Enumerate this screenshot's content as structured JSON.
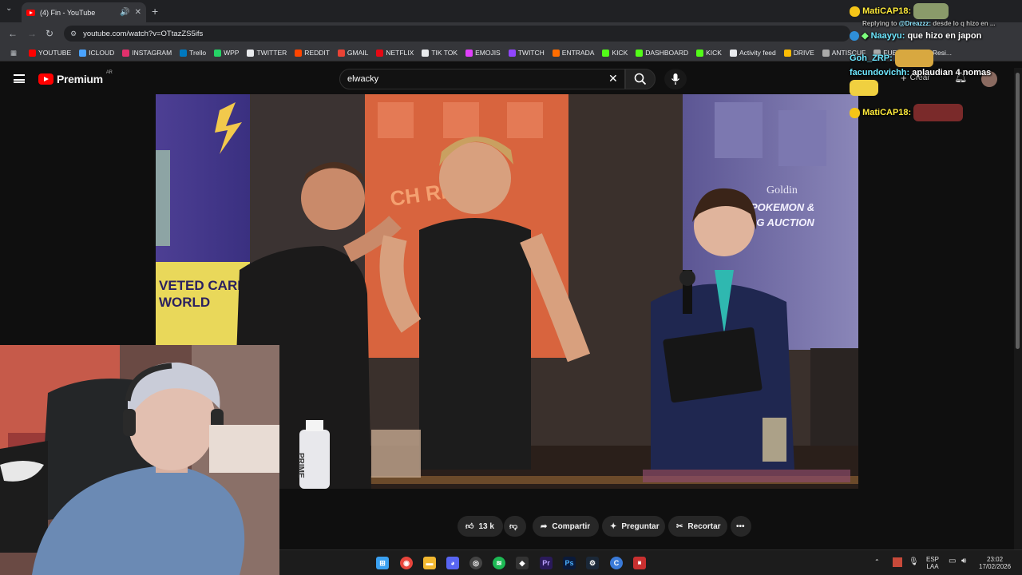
{
  "browser": {
    "tab_title": "(4) Fin - YouTube",
    "url": "youtube.com/watch?v=OTtazZS5ifs",
    "bookmarks": [
      {
        "label": "YOUTUBE",
        "color": "#ff0000"
      },
      {
        "label": "ICLOUD",
        "color": "#4aa3ff"
      },
      {
        "label": "INSTAGRAM",
        "color": "#e1306c"
      },
      {
        "label": "Trello",
        "color": "#0079bf"
      },
      {
        "label": "WPP",
        "color": "#25d366"
      },
      {
        "label": "TWITTER",
        "color": "#e8eaed"
      },
      {
        "label": "REDDIT",
        "color": "#ff4500"
      },
      {
        "label": "GMAIL",
        "color": "#ea4335"
      },
      {
        "label": "NETFLIX",
        "color": "#e50914"
      },
      {
        "label": "TIK TOK",
        "color": "#e8eaed"
      },
      {
        "label": "EMOJIS",
        "color": "#e040fb"
      },
      {
        "label": "TWITCH",
        "color": "#9146ff"
      },
      {
        "label": "ENTRADA",
        "color": "#ff6d00"
      },
      {
        "label": "KICK",
        "color": "#53fc18"
      },
      {
        "label": "DASHBOARD",
        "color": "#53fc18"
      },
      {
        "label": "KICK",
        "color": "#53fc18"
      },
      {
        "label": "Activity feed",
        "color": "#e8eaed"
      },
      {
        "label": "DRIVE",
        "color": "#fbbc04"
      },
      {
        "label": "ANTISCUF",
        "color": "#aaaaaa"
      },
      {
        "label": "FUENTES",
        "color": "#aaaaaa"
      },
      {
        "label": "Resi...",
        "color": "#aaaaaa"
      }
    ]
  },
  "youtube": {
    "logo_text": "Premium",
    "region": "AR",
    "search_value": "elwacky",
    "create_label": "Crear"
  },
  "video": {
    "sign_text_1": "VETED CARD",
    "sign_text_2": "WORLD",
    "sign_text_3": "Goldin",
    "sign_text_4": "POKEMON &",
    "sign_text_5": "TCG AUCTION",
    "bottle_text": "PRIME"
  },
  "chat": {
    "reply_prefix": "Replying to",
    "reply_user": "@Dreazzz:",
    "reply_text": "desde lo q hizo en ...",
    "messages": [
      {
        "user": "MatiCAP18:",
        "text": ""
      },
      {
        "user": "Naayyu:",
        "text": "que hizo en japon"
      },
      {
        "user": "Goh_ZRP:",
        "text": ""
      },
      {
        "user": "facundovichh:",
        "text": "aplaudian 4 nomas"
      },
      {
        "user": "MatiCAP18:",
        "text": ""
      }
    ]
  },
  "actions": {
    "likes": "13 k",
    "share": "Compartir",
    "ask": "Preguntar",
    "clip": "Recortar"
  },
  "taskbar": {
    "lang1": "ESP",
    "lang2": "LAA",
    "time": "23:02",
    "date": "17/02/2026"
  }
}
